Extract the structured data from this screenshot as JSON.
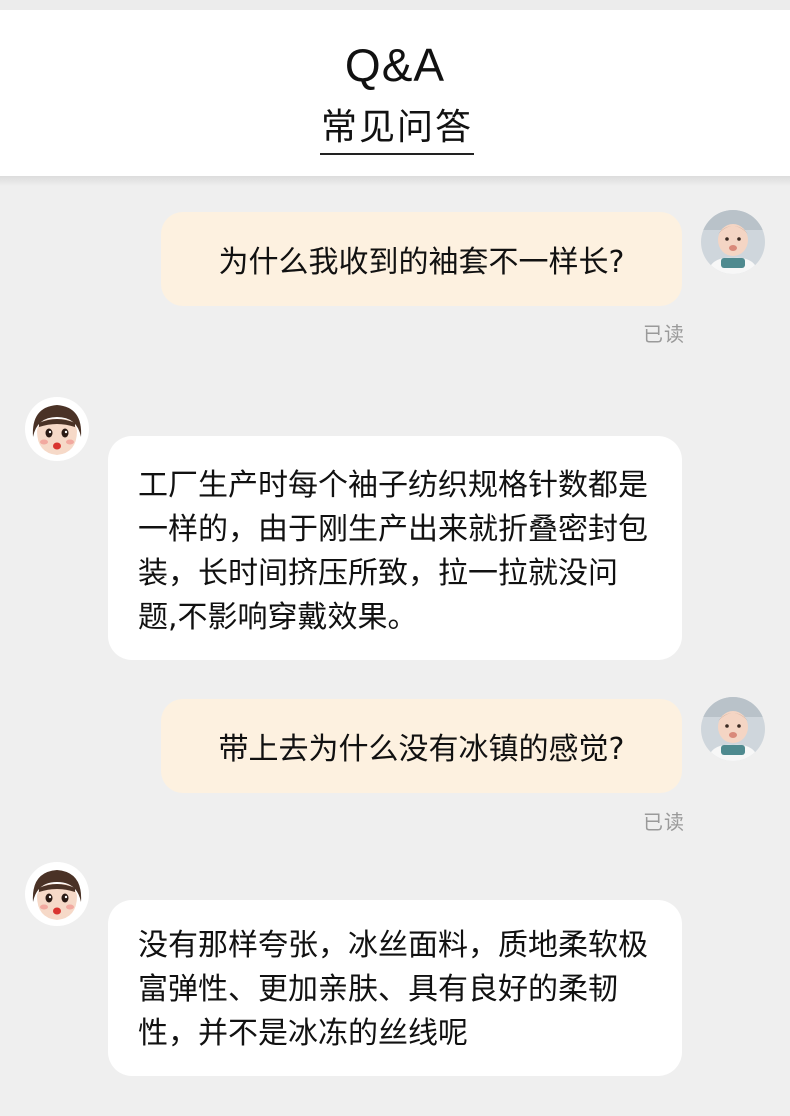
{
  "header": {
    "title_en": "Q&A",
    "title_cn": "常见问答"
  },
  "messages": [
    {
      "sender": "user",
      "text": "为什么我收到的袖套不一样长?",
      "status": "已读"
    },
    {
      "sender": "service",
      "text": "工厂生产时每个袖子纺织规格针数都是一样的，由于刚生产出来就折叠密封包装，长时间挤压所致，拉一拉就没问题,不影响穿戴效果。"
    },
    {
      "sender": "user",
      "text": "带上去为什么没有冰镇的感觉?",
      "status": "已读"
    },
    {
      "sender": "service",
      "text": "没有那样夸张，冰丝面料，质地柔软极富弹性、更加亲肤、具有良好的柔韧性，并不是冰冻的丝线呢"
    }
  ],
  "colors": {
    "page_bg": "#efefef",
    "user_bubble": "#fdf1e0",
    "reply_bubble": "#ffffff",
    "read_status": "#9a9a9a"
  }
}
